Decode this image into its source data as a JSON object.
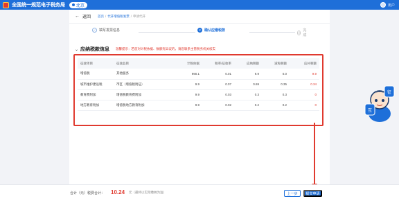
{
  "header": {
    "title": "全国统一规范电子税务局",
    "region": "北京",
    "user_name": "用户"
  },
  "nav": {
    "back_label": "返回",
    "breadcrumb": [
      "首页",
      "代开增值税发票",
      "申请代开"
    ]
  },
  "steps": [
    {
      "label": "填写发票信息",
      "status": "done",
      "marker": "✓"
    },
    {
      "label": "确认应缴税款",
      "status": "active",
      "marker": "2"
    },
    {
      "label": "完成",
      "status": "pending",
      "marker": "3"
    }
  ],
  "section": {
    "title": "应纳税款信息",
    "warning": "温馨提示：若您对计税依据、数额有异议的，请您联系主管税务机关核实"
  },
  "table": {
    "headers": [
      "征收项目",
      "征收品目",
      "计税依据",
      "税率/征收率",
      "应纳税额",
      "减免税额",
      "应补税额"
    ],
    "rows": [
      [
        "增值税",
        "其他服务",
        "990.1",
        "0.01",
        "9.9",
        "0.0",
        "9.9"
      ],
      [
        "城市维护建设税",
        "市区（增值税附征）",
        "9.9",
        "0.07",
        "0.69",
        "0.35",
        "0.34"
      ],
      [
        "教育费附加",
        "增值税教育费附加",
        "9.9",
        "0.03",
        "0.3",
        "0.3",
        "0"
      ],
      [
        "地方教育附加",
        "增值税地方教育附加",
        "9.9",
        "0.02",
        "0.2",
        "0.2",
        "0"
      ]
    ]
  },
  "footer": {
    "total_label": "合计（元）税费合计：",
    "total_value": "10.24",
    "total_unit": "元（最终以实际缴纳为准）",
    "prev_label": "上一步",
    "submit_label": "提交申请"
  },
  "mascot": {
    "text": "征纳互动"
  },
  "colors": {
    "brand_blue": "#1e6fd9",
    "alert_red": "#e03a2f"
  }
}
